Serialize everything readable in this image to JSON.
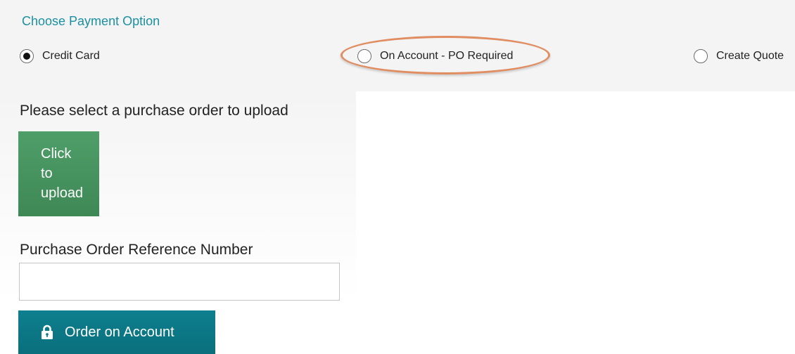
{
  "payment": {
    "title": "Choose Payment Option",
    "options": [
      {
        "label": "Credit Card",
        "checked": true
      },
      {
        "label": "On Account - PO Required",
        "checked": false,
        "highlighted": true
      },
      {
        "label": "Create Quote",
        "checked": false
      }
    ]
  },
  "upload": {
    "prompt": "Please select a purchase order to upload",
    "button_lines": [
      "Click",
      "to",
      "upload"
    ]
  },
  "po": {
    "label": "Purchase Order Reference Number",
    "value": "",
    "placeholder": ""
  },
  "order_button": {
    "label": "Order on Account",
    "icon": "lock-icon"
  },
  "colors": {
    "accent": "#1b8fa3",
    "upload_button": "#4a9a64",
    "order_button": "#0b7785",
    "highlight": "#e08d62"
  }
}
